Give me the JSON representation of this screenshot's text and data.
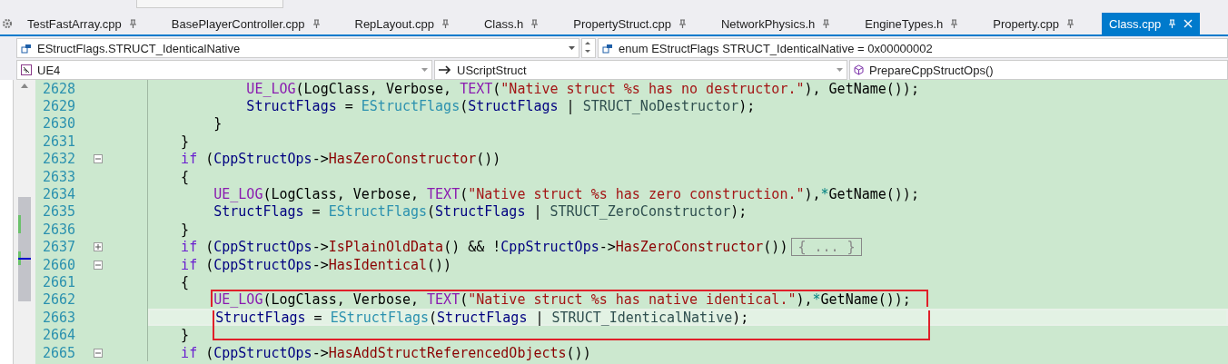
{
  "tabs": [
    {
      "label": "TestFastArray.cpp",
      "selected": false
    },
    {
      "label": "BasePlayerController.cpp",
      "selected": false
    },
    {
      "label": "RepLayout.cpp",
      "selected": false
    },
    {
      "label": "Class.h",
      "selected": false
    },
    {
      "label": "PropertyStruct.cpp",
      "selected": false
    },
    {
      "label": "NetworkPhysics.h",
      "selected": false
    },
    {
      "label": "EngineTypes.h",
      "selected": false
    },
    {
      "label": "Property.cpp",
      "selected": false
    },
    {
      "label": "Class.cpp",
      "selected": true
    }
  ],
  "symbol_bar": {
    "member": "EStructFlags.STRUCT_IdenticalNative",
    "definition": "enum EStructFlags STRUCT_IdenticalNative = 0x00000002"
  },
  "navigation_bar": {
    "project": "UE4",
    "scope": "UScriptStruct",
    "function": "PrepareCppStructOps()"
  },
  "code_lines": [
    {
      "number": "2628",
      "current": false,
      "boxed": false,
      "tokens": [
        {
          "text": "            UE_LOG",
          "kind": "macro"
        },
        {
          "text": "(LogClass, Verbose, ",
          "kind": "plain"
        },
        {
          "text": "TEXT",
          "kind": "macro"
        },
        {
          "text": "(",
          "kind": "plain"
        },
        {
          "text": "\"Native struct %s has no destructor.\"",
          "kind": "string"
        },
        {
          "text": "), GetName());",
          "kind": "plain"
        }
      ]
    },
    {
      "number": "2629",
      "current": false,
      "boxed": false,
      "tokens": [
        {
          "text": "            StructFlags",
          "kind": "ident"
        },
        {
          "text": " = ",
          "kind": "plain"
        },
        {
          "text": "EStructFlags",
          "kind": "type"
        },
        {
          "text": "(",
          "kind": "plain"
        },
        {
          "text": "StructFlags",
          "kind": "ident"
        },
        {
          "text": " | ",
          "kind": "plain"
        },
        {
          "text": "STRUCT_NoDestructor",
          "kind": "enum"
        },
        {
          "text": ");",
          "kind": "plain"
        }
      ]
    },
    {
      "number": "2630",
      "current": false,
      "boxed": false,
      "tokens": [
        {
          "text": "        }",
          "kind": "plain"
        }
      ]
    },
    {
      "number": "2631",
      "current": false,
      "boxed": false,
      "tokens": [
        {
          "text": "    }",
          "kind": "plain"
        }
      ]
    },
    {
      "number": "2632",
      "expanded": true,
      "current": false,
      "boxed": false,
      "tokens": [
        {
          "text": "    if",
          "kind": "keyword"
        },
        {
          "text": " (",
          "kind": "plain"
        },
        {
          "text": "CppStructOps",
          "kind": "ident"
        },
        {
          "text": "->",
          "kind": "plain"
        },
        {
          "text": "HasZeroConstructor",
          "kind": "func"
        },
        {
          "text": "())",
          "kind": "plain"
        }
      ]
    },
    {
      "number": "2633",
      "current": false,
      "boxed": false,
      "tokens": [
        {
          "text": "    {",
          "kind": "plain"
        }
      ]
    },
    {
      "number": "2634",
      "current": false,
      "boxed": false,
      "tokens": [
        {
          "text": "        UE_LOG",
          "kind": "macro"
        },
        {
          "text": "(LogClass, Verbose, ",
          "kind": "plain"
        },
        {
          "text": "TEXT",
          "kind": "macro"
        },
        {
          "text": "(",
          "kind": "plain"
        },
        {
          "text": "\"Native struct %s has zero construction.\"",
          "kind": "string"
        },
        {
          "text": "),",
          "kind": "plain"
        },
        {
          "text": "*",
          "kind": "op"
        },
        {
          "text": "GetName());",
          "kind": "plain"
        }
      ]
    },
    {
      "number": "2635",
      "current": false,
      "boxed": false,
      "tokens": [
        {
          "text": "        StructFlags",
          "kind": "ident"
        },
        {
          "text": " = ",
          "kind": "plain"
        },
        {
          "text": "EStructFlags",
          "kind": "type"
        },
        {
          "text": "(",
          "kind": "plain"
        },
        {
          "text": "StructFlags",
          "kind": "ident"
        },
        {
          "text": " | ",
          "kind": "plain"
        },
        {
          "text": "STRUCT_ZeroConstructor",
          "kind": "enum"
        },
        {
          "text": ");",
          "kind": "plain"
        }
      ]
    },
    {
      "number": "2636",
      "current": false,
      "boxed": false,
      "tokens": [
        {
          "text": "    }",
          "kind": "plain"
        }
      ]
    },
    {
      "number": "2637",
      "expanded": false,
      "current": false,
      "boxed": false,
      "tokens": [
        {
          "text": "    if",
          "kind": "keyword"
        },
        {
          "text": " (",
          "kind": "plain"
        },
        {
          "text": "CppStructOps",
          "kind": "ident"
        },
        {
          "text": "->",
          "kind": "plain"
        },
        {
          "text": "IsPlainOldData",
          "kind": "func"
        },
        {
          "text": "() && !",
          "kind": "plain"
        },
        {
          "text": "CppStructOps",
          "kind": "ident"
        },
        {
          "text": "->",
          "kind": "plain"
        },
        {
          "text": "HasZeroConstructor",
          "kind": "func"
        },
        {
          "text": "())",
          "kind": "plain"
        },
        {
          "text": "{ ... }",
          "kind": "collapsed"
        }
      ]
    },
    {
      "number": "2660",
      "expanded": true,
      "current": false,
      "boxed": false,
      "tokens": [
        {
          "text": "    if",
          "kind": "keyword"
        },
        {
          "text": " (",
          "kind": "plain"
        },
        {
          "text": "CppStructOps",
          "kind": "ident"
        },
        {
          "text": "->",
          "kind": "plain"
        },
        {
          "text": "HasIdentical",
          "kind": "func"
        },
        {
          "text": "())",
          "kind": "plain"
        }
      ]
    },
    {
      "number": "2661",
      "current": false,
      "boxed": false,
      "tokens": [
        {
          "text": "    {",
          "kind": "plain"
        }
      ]
    },
    {
      "number": "2662",
      "current": false,
      "boxed": true,
      "tokens": [
        {
          "text": "        UE_LOG",
          "kind": "macro"
        },
        {
          "text": "(LogClass, Verbose, ",
          "kind": "plain"
        },
        {
          "text": "TEXT",
          "kind": "macro"
        },
        {
          "text": "(",
          "kind": "plain"
        },
        {
          "text": "\"Native struct %s has native identical.\"",
          "kind": "string"
        },
        {
          "text": "),",
          "kind": "plain"
        },
        {
          "text": "*",
          "kind": "op"
        },
        {
          "text": "GetName());",
          "kind": "plain"
        }
      ]
    },
    {
      "number": "2663",
      "current": true,
      "boxed": true,
      "tokens": [
        {
          "text": "        StructFlags",
          "kind": "ident"
        },
        {
          "text": " = ",
          "kind": "plain"
        },
        {
          "text": "EStructFlags",
          "kind": "type"
        },
        {
          "text": "(",
          "kind": "plain"
        },
        {
          "text": "StructFlags",
          "kind": "ident"
        },
        {
          "text": " | ",
          "kind": "plain"
        },
        {
          "text": "STRUCT_IdenticalNative",
          "kind": "enum"
        },
        {
          "text": ");",
          "kind": "plain"
        }
      ]
    },
    {
      "number": "2664",
      "current": false,
      "boxed": false,
      "tokens": [
        {
          "text": "    }",
          "kind": "plain"
        }
      ]
    },
    {
      "number": "2665",
      "expanded": true,
      "current": false,
      "boxed": false,
      "tokens": [
        {
          "text": "    if",
          "kind": "keyword"
        },
        {
          "text": " (",
          "kind": "plain"
        },
        {
          "text": "CppStructOps",
          "kind": "ident"
        },
        {
          "text": "->",
          "kind": "plain"
        },
        {
          "text": "HasAddStructReferencedObjects",
          "kind": "func"
        },
        {
          "text": "())",
          "kind": "plain"
        }
      ]
    }
  ]
}
